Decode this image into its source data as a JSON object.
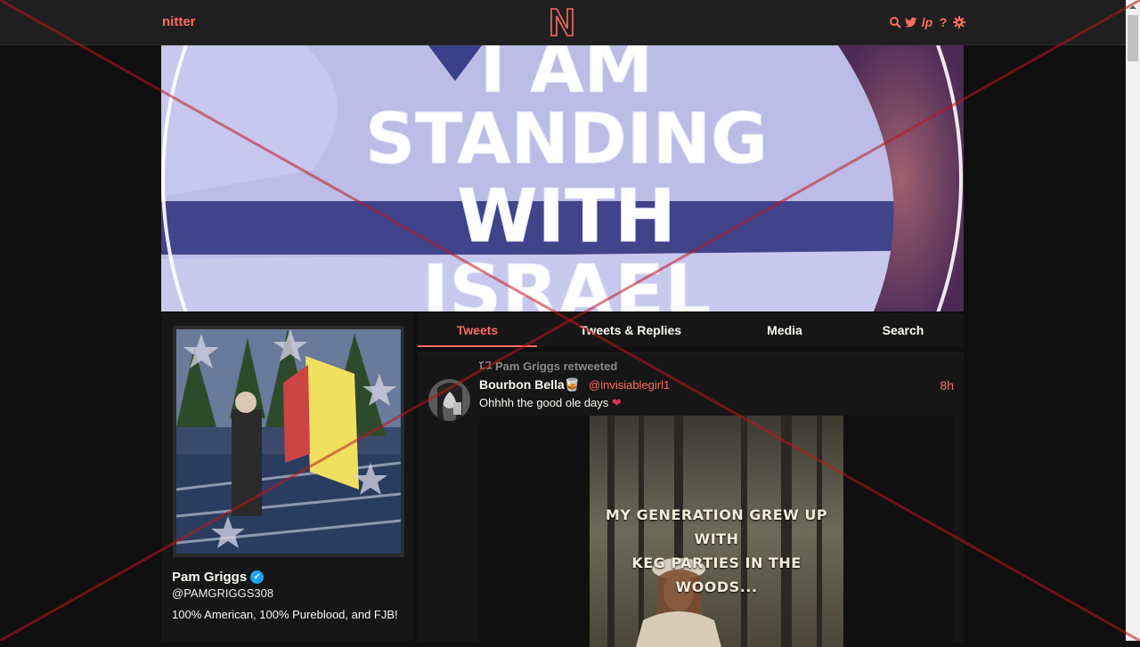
{
  "nav": {
    "brand": "nitter",
    "logo_letter": "N",
    "icons": [
      "search-icon",
      "twitter-bird-icon",
      "lp-icon",
      "help-icon",
      "gear-icon"
    ],
    "lp_text": "lp",
    "help_text": "?"
  },
  "banner": {
    "lines": [
      "I AM",
      "STANDING",
      "WITH",
      "ISRAEL"
    ]
  },
  "profile": {
    "name": "Pam Griggs",
    "verified": true,
    "handle": "@PAMGRIGGS308",
    "bio": "100% American, 100% Pureblood, and FJB!"
  },
  "tabs": [
    {
      "label": "Tweets",
      "active": true
    },
    {
      "label": "Tweets & Replies",
      "active": false
    },
    {
      "label": "Media",
      "active": false
    },
    {
      "label": "Search",
      "active": false
    }
  ],
  "tweet": {
    "retweet_header": "Pam Griggs retweeted",
    "fullname": "Bourbon Bella",
    "fullname_emoji": "🥃",
    "username": "@invisiablegirl1",
    "date": "8h",
    "text": "Ohhhh the good ole days",
    "text_emoji": "❤",
    "media_caption_line1": "MY GENERATION GREW UP WITH",
    "media_caption_line2": "KEG PARTIES IN THE WOODS..."
  },
  "colors": {
    "accent": "#ff6c60",
    "background": "#0f0f0f",
    "panel": "#161616",
    "nav": "#1f1f1f",
    "verified": "#1da1f2"
  }
}
